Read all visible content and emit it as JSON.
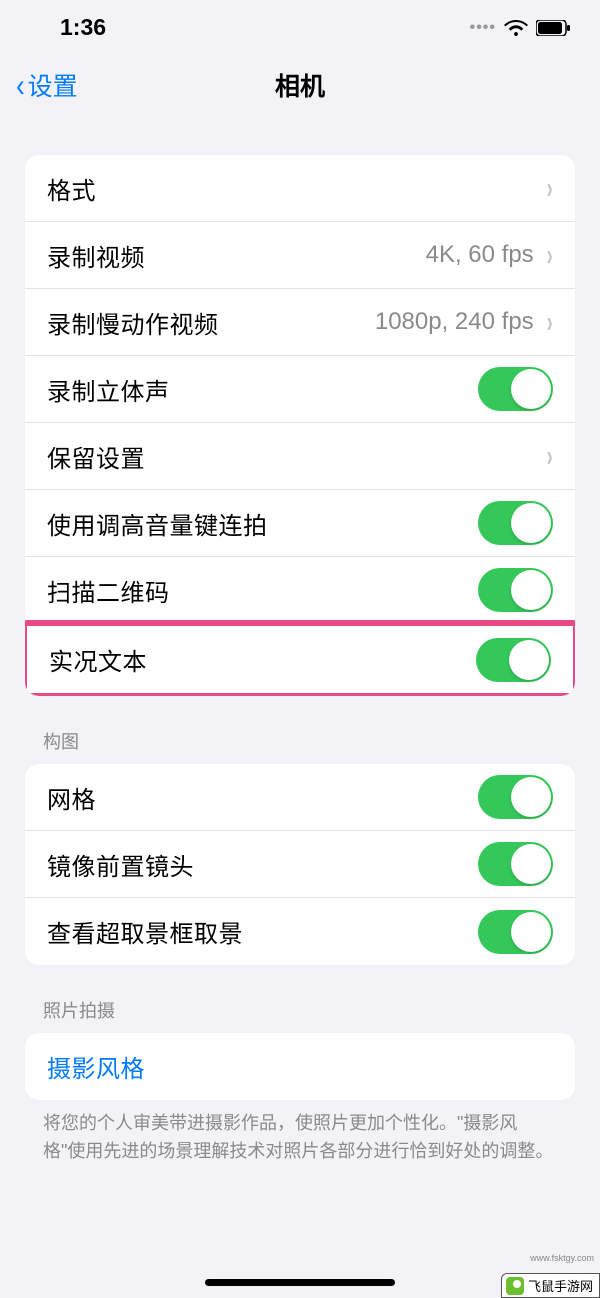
{
  "status": {
    "time": "1:36"
  },
  "nav": {
    "back": "设置",
    "title": "相机"
  },
  "group1": {
    "formats": "格式",
    "recordVideo": {
      "label": "录制视频",
      "value": "4K, 60 fps"
    },
    "recordSlomo": {
      "label": "录制慢动作视频",
      "value": "1080p, 240 fps"
    },
    "stereo": "录制立体声",
    "preserve": "保留设置",
    "volumeBurst": "使用调高音量键连拍",
    "qrScan": "扫描二维码",
    "liveText": "实况文本"
  },
  "composition": {
    "header": "构图",
    "grid": "网格",
    "mirrorFront": "镜像前置镜头",
    "viewOutside": "查看超取景框取景"
  },
  "photoCapture": {
    "header": "照片拍摄",
    "styles": "摄影风格",
    "footer": "将您的个人审美带进摄影作品，使照片更加个性化。\"摄影风格\"使用先进的场景理解技术对照片各部分进行恰到好处的调整。"
  },
  "watermark": {
    "text": "飞鼠手游网",
    "url": "www.fsktgy.com"
  }
}
